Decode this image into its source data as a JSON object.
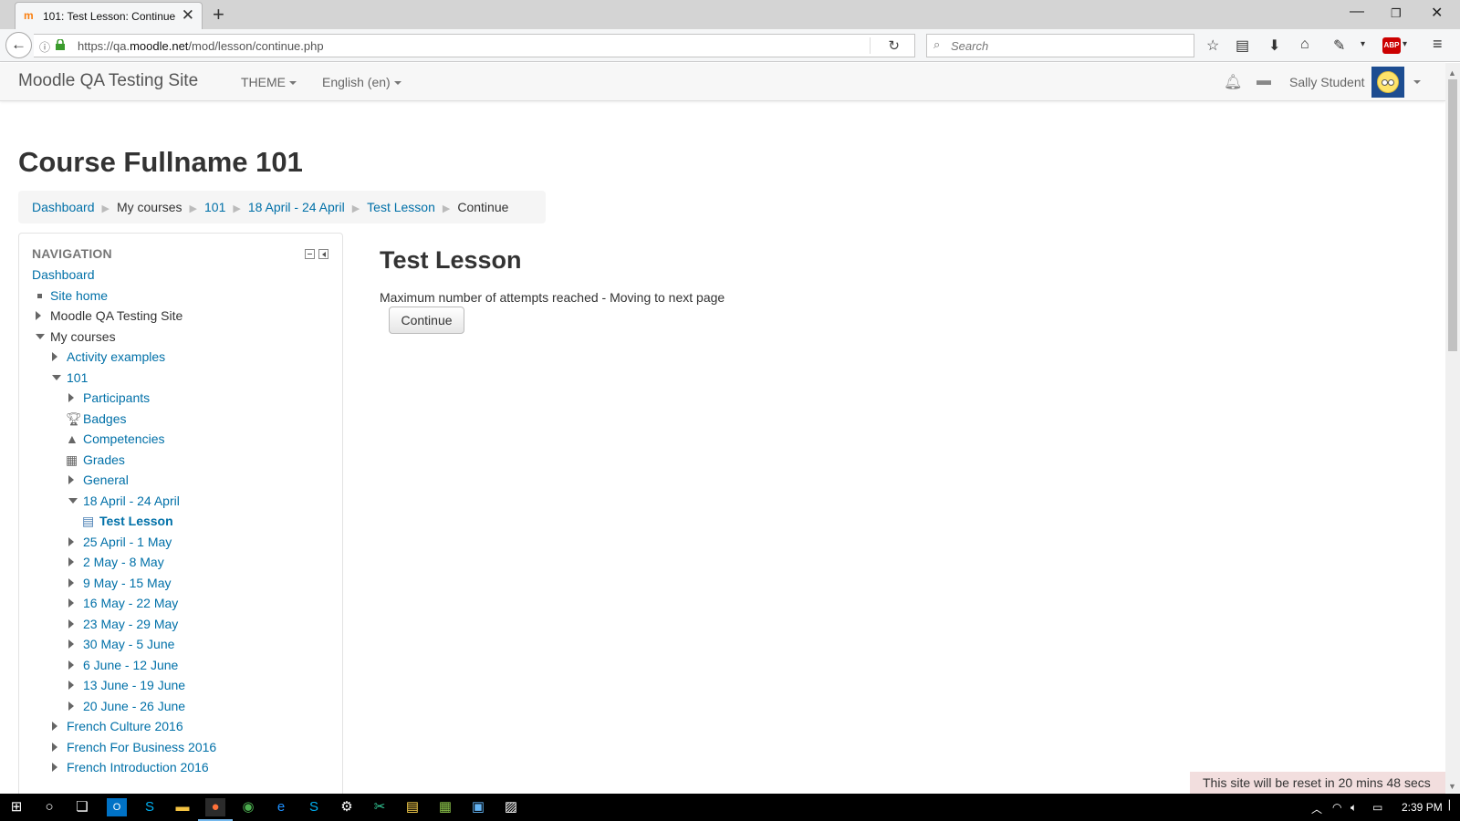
{
  "browser": {
    "tab_title": "101: Test Lesson: Continue",
    "tab_favicon": "m",
    "url_prefix": "https://qa.",
    "url_domain": "moodle.net",
    "url_path": "/mod/lesson/continue.php",
    "search_placeholder": "Search",
    "abp_label": "ABP"
  },
  "navbar": {
    "brand": "Moodle QA Testing Site",
    "theme_menu": "THEME",
    "language_menu": "English (en)",
    "user_name": "Sally Student"
  },
  "page": {
    "course_title": "Course Fullname 101",
    "breadcrumb": [
      {
        "label": "Dashboard",
        "link": true
      },
      {
        "label": "My courses",
        "link": false
      },
      {
        "label": "101",
        "link": true
      },
      {
        "label": "18 April - 24 April",
        "link": true
      },
      {
        "label": "Test Lesson",
        "link": true
      },
      {
        "label": "Continue",
        "link": false
      }
    ],
    "breadcrumb_divider": "▶"
  },
  "navigation": {
    "header": "NAVIGATION",
    "items": [
      {
        "label": "Dashboard",
        "marker": "none",
        "style": "link"
      },
      {
        "label": "Site home",
        "marker": "bullet",
        "style": "link"
      },
      {
        "label": "Moodle QA Testing Site",
        "marker": "collapsed",
        "style": "plain"
      },
      {
        "label": "My courses",
        "marker": "expanded",
        "style": "plain"
      },
      {
        "label": "Activity examples",
        "marker": "collapsed",
        "style": "link"
      },
      {
        "label": "101",
        "marker": "expanded",
        "style": "link"
      },
      {
        "label": "Participants",
        "marker": "collapsed",
        "style": "link"
      },
      {
        "label": "Badges",
        "marker": "trophy-icon",
        "style": "link"
      },
      {
        "label": "Competencies",
        "marker": "competency-icon",
        "style": "link"
      },
      {
        "label": "Grades",
        "marker": "grades-table-icon",
        "style": "link"
      },
      {
        "label": "General",
        "marker": "collapsed",
        "style": "link"
      },
      {
        "label": "18 April - 24 April",
        "marker": "expanded",
        "style": "link"
      },
      {
        "label": "Test Lesson",
        "marker": "lesson-icon",
        "style": "bold"
      },
      {
        "label": "25 April - 1 May",
        "marker": "collapsed",
        "style": "link"
      },
      {
        "label": "2 May - 8 May",
        "marker": "collapsed",
        "style": "link"
      },
      {
        "label": "9 May - 15 May",
        "marker": "collapsed",
        "style": "link"
      },
      {
        "label": "16 May - 22 May",
        "marker": "collapsed",
        "style": "link"
      },
      {
        "label": "23 May - 29 May",
        "marker": "collapsed",
        "style": "link"
      },
      {
        "label": "30 May - 5 June",
        "marker": "collapsed",
        "style": "link"
      },
      {
        "label": "6 June - 12 June",
        "marker": "collapsed",
        "style": "link"
      },
      {
        "label": "13 June - 19 June",
        "marker": "collapsed",
        "style": "link"
      },
      {
        "label": "20 June - 26 June",
        "marker": "collapsed",
        "style": "link"
      },
      {
        "label": "French Culture 2016",
        "marker": "collapsed",
        "style": "link"
      },
      {
        "label": "French For Business 2016",
        "marker": "collapsed",
        "style": "link"
      },
      {
        "label": "French Introduction 2016",
        "marker": "collapsed",
        "style": "link"
      }
    ]
  },
  "lesson": {
    "title": "Test Lesson",
    "message": "Maximum number of attempts reached - Moving to next page",
    "continue_label": "Continue"
  },
  "reset_banner": "This site will be reset in 20 mins 48 secs",
  "taskbar": {
    "clock": "2:39 PM"
  },
  "colors": {
    "link": "#0070a8",
    "banner_bg": "#f2dede",
    "avatar_bg": "#1d4d91"
  }
}
